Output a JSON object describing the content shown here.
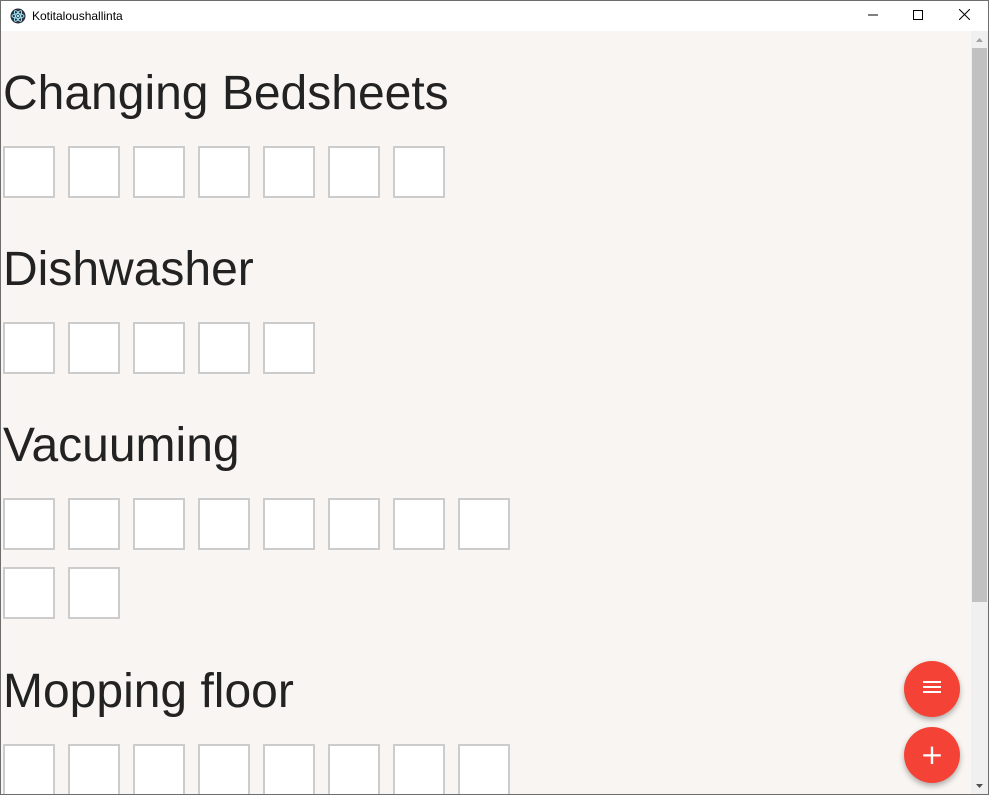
{
  "window": {
    "title": "Kotitaloushallinta",
    "app_icon": "electron-atom-icon",
    "controls": [
      "minimize-icon",
      "maximize-icon",
      "close-icon"
    ]
  },
  "sections": [
    {
      "title": "Changing Bedsheets",
      "box_count": 7
    },
    {
      "title": "Dishwasher",
      "box_count": 5
    },
    {
      "title": "Vacuuming",
      "box_count": 10
    },
    {
      "title": "Mopping floor",
      "box_count": 8
    }
  ],
  "fabs": [
    {
      "icon": "menu-icon"
    },
    {
      "icon": "plus-icon",
      "label": "+"
    }
  ],
  "colors": {
    "background": "#f8f5f2",
    "box_border": "#cccccc",
    "fab": "#f44336",
    "title_text": "#222222"
  }
}
